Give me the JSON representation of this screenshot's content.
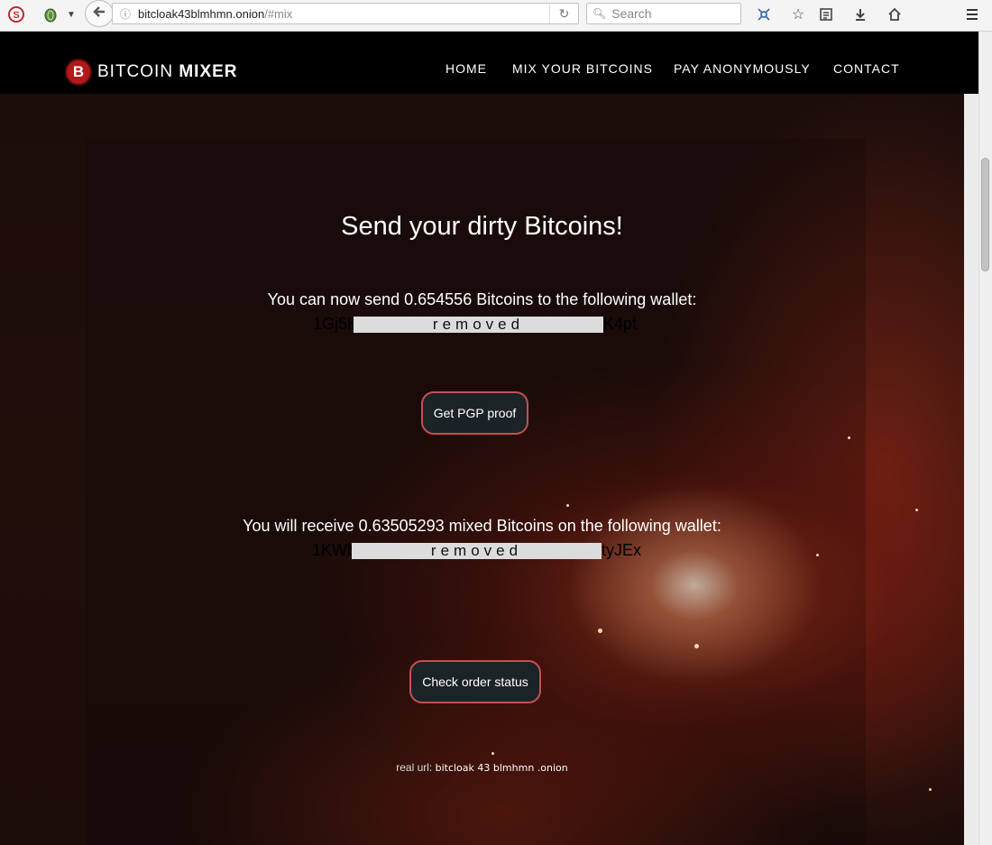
{
  "browser": {
    "url_host": "bitcloak43blmhmn.onion",
    "url_path": "/#mix",
    "search_placeholder": "Search",
    "icons": [
      "noscript-icon",
      "tor-onion-icon",
      "dropdown-arrow-icon",
      "back-arrow-icon",
      "info-icon",
      "reload-icon",
      "search-icon",
      "bookmark-star-icon",
      "reader-list-icon",
      "download-icon",
      "home-icon",
      "menu-icon",
      "network-icon"
    ]
  },
  "site": {
    "logo_symbol": "B",
    "brand_word1": "BITCOIN",
    "brand_word2": "MIXER",
    "nav": [
      "HOME",
      "MIX YOUR BITCOINS",
      "PAY ANONYMOUSLY",
      "CONTACT"
    ]
  },
  "main": {
    "headline": "Send your dirty Bitcoins!",
    "send_text": "You can now send 0.654556 Bitcoins to the following wallet:",
    "send_wallet_prefix": "1Gj5K",
    "send_wallet_suffix": "K4pt",
    "redacted_label": "removed",
    "pgp_button": "Get PGP proof",
    "receive_text": "You will receive 0.63505293 mixed Bitcoins on the following wallet:",
    "receive_wallet_prefix": "1KWb",
    "receive_wallet_suffix": "tyJEx",
    "status_button": "Check order status",
    "real_url_label": "real url:",
    "real_url_value": "bitcloak 43 blmhmn .onion"
  },
  "colors": {
    "header_bg": "#000000",
    "button_border": "#c25151",
    "button_bg": "#1c2327",
    "logo_red": "#b3181a"
  }
}
